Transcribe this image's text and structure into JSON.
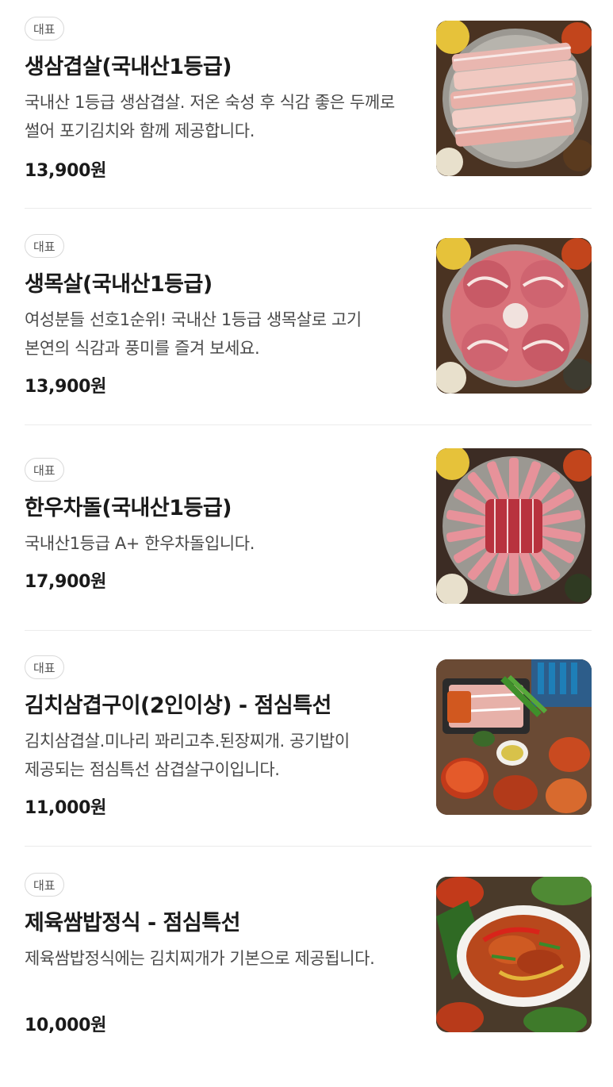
{
  "menu": {
    "items": [
      {
        "badge": "대표",
        "title": "생삼겹살(국내산1등급)",
        "description": "국내산 1등급 생삼겹살. 저온 숙성 후 식감 좋은 두께로 썰어 포기김치와 함께 제공합니다.",
        "price": "13,900원",
        "image_icon": "pork-belly-image"
      },
      {
        "badge": "대표",
        "title": "생목살(국내산1등급)",
        "description": "여성분들 선호1순위! 국내산 1등급 생목살로 고기 본연의 식감과 풍미를 즐겨 보세요.",
        "price": "13,900원",
        "image_icon": "pork-neck-image"
      },
      {
        "badge": "대표",
        "title": "한우차돌(국내산1등급)",
        "description": "국내산1등급 A+ 한우차돌입니다.",
        "price": "17,900원",
        "image_icon": "beef-brisket-image"
      },
      {
        "badge": "대표",
        "title": "김치삼겹구이(2인이상) - 점심특선",
        "description": "김치삼겹살.미나리 꽈리고추.된장찌개. 공기밥이 제공되는 점심특선 삼겹살구이입니다.",
        "price": "11,000원",
        "image_icon": "kimchi-pork-set-image"
      },
      {
        "badge": "대표",
        "title": "제육쌈밥정식 - 점심특선",
        "description": "제육쌈밥정식에는 김치찌개가 기본으로 제공됩니다.",
        "price": "10,000원",
        "image_icon": "spicy-pork-set-image"
      }
    ]
  }
}
